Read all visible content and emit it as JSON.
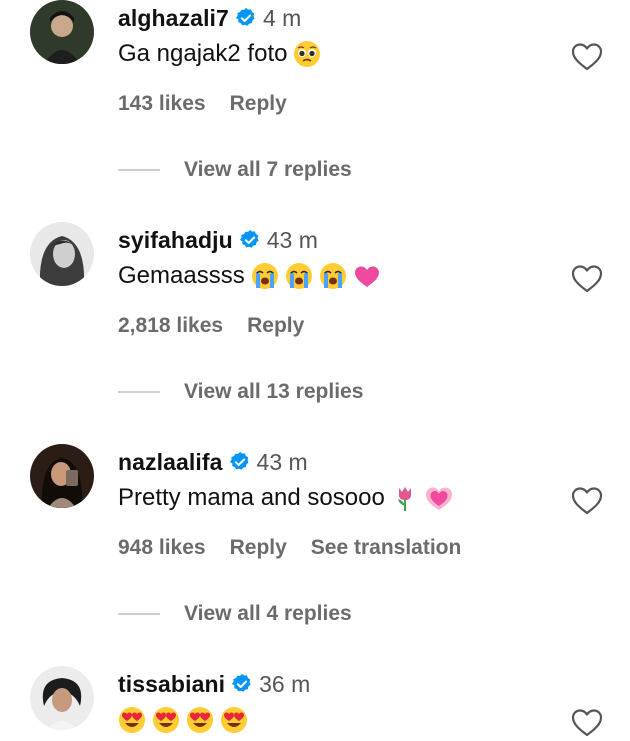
{
  "comments": [
    {
      "username": "alghazali7",
      "time": "4 m",
      "text": "Ga ngajak2 foto",
      "emojis": [
        "pleading-face-emoji"
      ],
      "likes": "143 likes",
      "reply": "Reply",
      "translate": "",
      "view_replies": "View all 7 replies",
      "avatar_color": "#2f3a2a"
    },
    {
      "username": "syifahadju",
      "time": "43 m",
      "text": "Gemaassss",
      "emojis": [
        "crying-face-emoji",
        "crying-face-emoji",
        "crying-face-emoji",
        "pink-heart-emoji"
      ],
      "likes": "2,818 likes",
      "reply": "Reply",
      "translate": "",
      "view_replies": "View all 13 replies",
      "avatar_color": "#8c8c8c"
    },
    {
      "username": "nazlaalifa",
      "time": "43 m",
      "text": "Pretty mama and sosooo",
      "emojis": [
        "tulip-emoji",
        "growing-heart-emoji"
      ],
      "likes": "948 likes",
      "reply": "Reply",
      "translate": "See translation",
      "view_replies": "View all 4 replies",
      "avatar_color": "#3a2a22"
    },
    {
      "username": "tissabiani",
      "time": "36 m",
      "text": "",
      "emojis": [
        "heart-eyes-emoji",
        "heart-eyes-emoji",
        "heart-eyes-emoji",
        "heart-eyes-emoji"
      ],
      "likes": "",
      "reply": "",
      "translate": "",
      "view_replies": "",
      "avatar_color": "#d9d9d9"
    }
  ],
  "colors": {
    "verified_blue": "#0095f6",
    "secondary_text": "#6b6b6b",
    "primary_text": "#111111"
  }
}
